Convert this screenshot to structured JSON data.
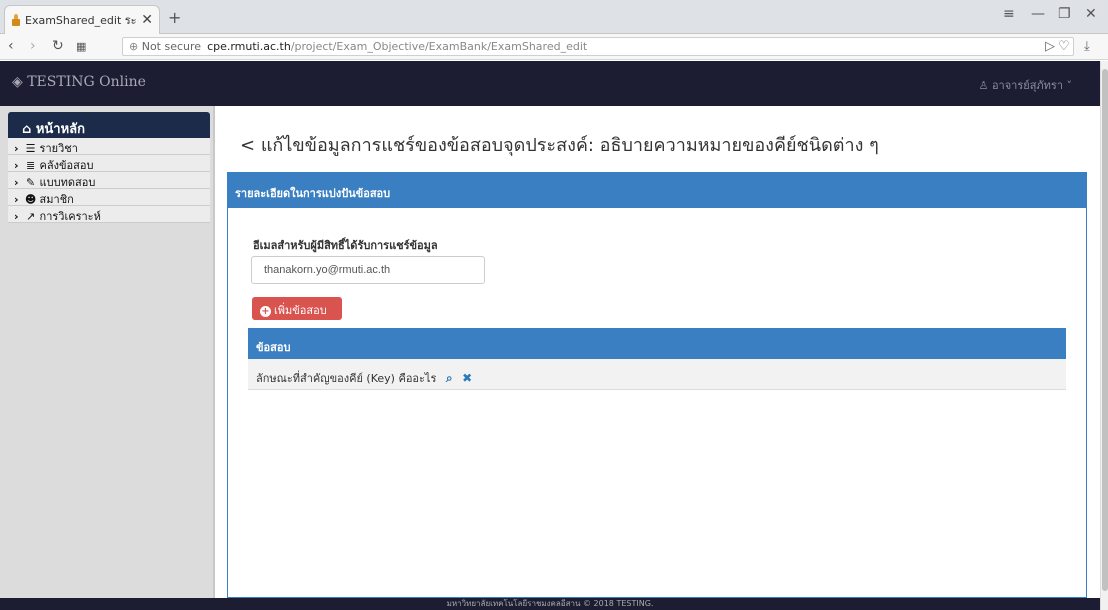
{
  "browser": {
    "tab_title": "ExamShared_edit ระบบวิเคร",
    "tab_close": "✕",
    "new_tab": "+",
    "not_secure": "Not secure",
    "url_domain": "cpe.rmuti.ac.th",
    "url_path": "/project/Exam_Objective/ExamBank/ExamShared_edit"
  },
  "header": {
    "brand": "TESTING Online",
    "user": "อาจารย์สุภัทรา"
  },
  "sidebar": {
    "home": "หน้าหลัก",
    "items": [
      {
        "label": "รายวิชา"
      },
      {
        "label": "คลังข้อสอบ"
      },
      {
        "label": "แบบทดสอบ"
      },
      {
        "label": "สมาชิก"
      },
      {
        "label": "การวิเคราะห์"
      }
    ]
  },
  "main": {
    "title": "แก้ไขข้อมูลการแชร์ของข้อสอบจุดประสงค์: อธิบายความหมายของคีย์ชนิดต่าง ๆ",
    "panel_heading": "รายละเอียดในการแบ่งปันข้อสอบ",
    "email_label": "อีเมลสำหรับผู้มีสิทธิ์ได้รับการแชร์ข้อมูล",
    "email_value": "thanakorn.yo@rmuti.ac.th",
    "add_button": "เพิ่มข้อสอบ",
    "table_header": "ข้อสอบ",
    "rows": [
      {
        "question": "ลักษณะที่สำคัญของคีย์ (Key) คืออะไร"
      }
    ]
  },
  "footer": {
    "text": "มหาวิทยาลัยเทคโนโลยีราชมงคลอีสาน © 2018 TESTING."
  }
}
